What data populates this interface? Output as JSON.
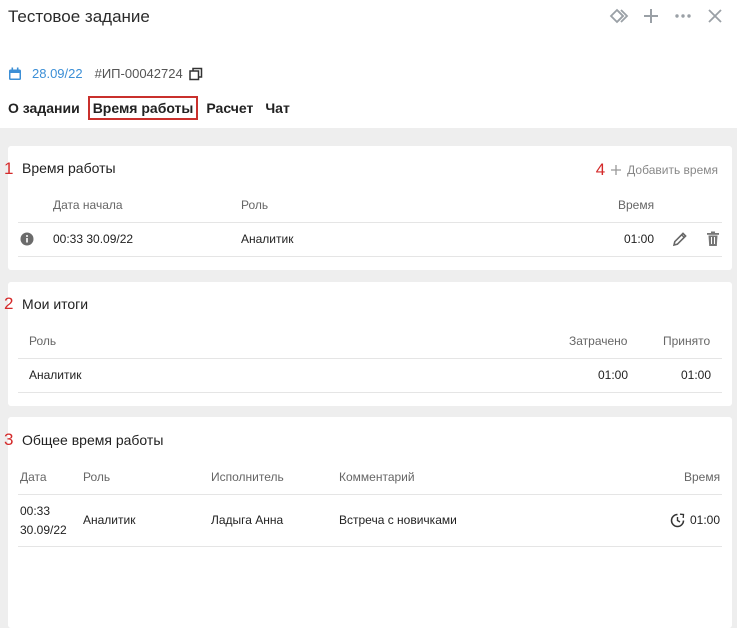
{
  "window": {
    "title": "Тестовое задание",
    "icons": [
      "diamond-icon",
      "plus-icon",
      "more-icon",
      "close-icon"
    ]
  },
  "task": {
    "date": "28.09/22",
    "number": "#ИП-00042724"
  },
  "tabs": [
    {
      "label": "О задании",
      "active": false
    },
    {
      "label": "Время работы",
      "active": true
    },
    {
      "label": "Расчет",
      "active": false
    },
    {
      "label": "Чат",
      "active": false
    }
  ],
  "markers": [
    "1",
    "2",
    "3",
    "4"
  ],
  "work_time": {
    "title": "Время работы",
    "add_label": "Добавить время",
    "columns": {
      "start": "Дата начала",
      "role": "Роль",
      "time": "Время"
    },
    "rows": [
      {
        "start": "00:33 30.09/22",
        "role": "Аналитик",
        "time": "01:00"
      }
    ]
  },
  "my_totals": {
    "title": "Мои итоги",
    "columns": {
      "role": "Роль",
      "spent": "Затрачено",
      "accepted": "Принято"
    },
    "rows": [
      {
        "role": "Аналитик",
        "spent": "01:00",
        "accepted": "01:00"
      }
    ]
  },
  "total_time": {
    "title": "Общее время работы",
    "columns": {
      "date": "Дата",
      "role": "Роль",
      "performer": "Исполнитель",
      "comment": "Комментарий",
      "time": "Время"
    },
    "rows": [
      {
        "time_of_day": "00:33",
        "date": "30.09/22",
        "role": "Аналитик",
        "performer": "Ладыга Анна",
        "comment": "Встреча с новичками",
        "time": "01:00"
      }
    ]
  },
  "colors": {
    "accent": "#3c8fd6",
    "marker": "#d42a2a",
    "tab_outline": "#c9302c",
    "background": "#eeeeee"
  }
}
